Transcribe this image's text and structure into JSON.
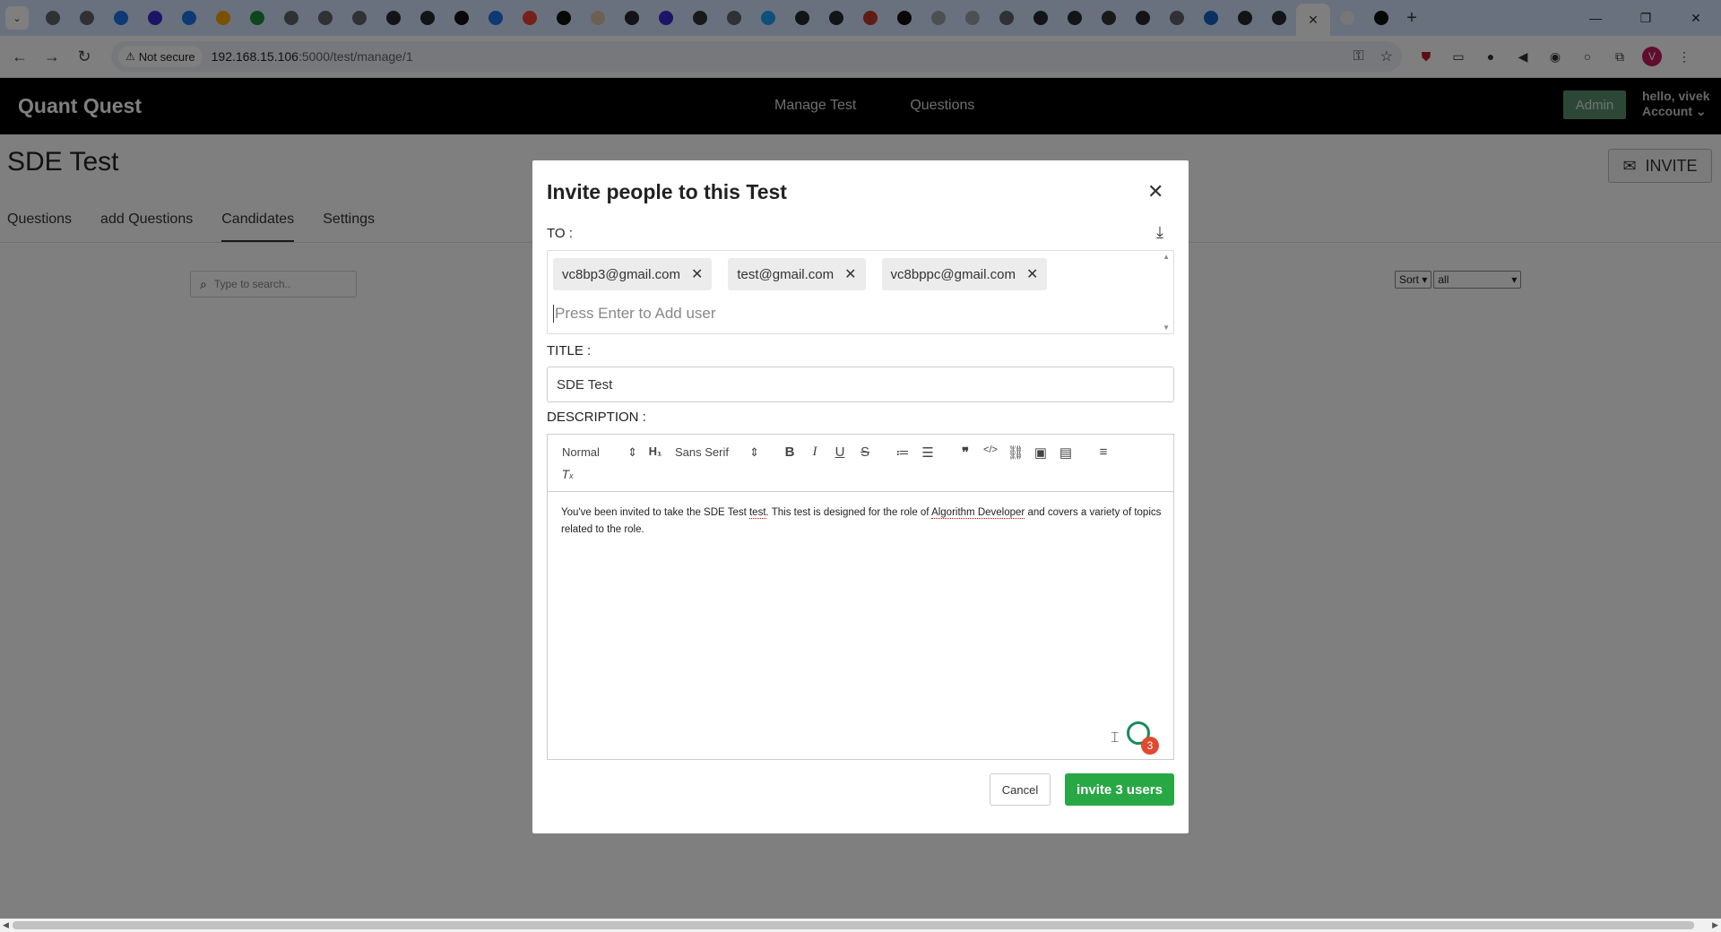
{
  "browser": {
    "tab_icons": [
      "chrome",
      "chrome",
      "google",
      "shield",
      "refresh",
      "orange",
      "n-logo",
      "chrome",
      "chrome",
      "chrome",
      "github",
      "github",
      "ai",
      "google",
      "maps",
      "medium",
      "chat",
      "circle",
      "hex",
      "x",
      "chrome",
      "twitter",
      "github",
      "github",
      "castle",
      "square",
      "cursor",
      "cursor",
      "chrome",
      "github",
      "circle",
      "x",
      "circle",
      "chrome",
      "hex",
      "github",
      "github",
      "doc",
      "ms"
    ],
    "active_tab_close": "✕",
    "not_secure": "Not secure",
    "url_host": "192.168.15.106",
    "url_path": ":5000/test/manage/1",
    "avatar_letter": "V"
  },
  "app": {
    "brand": "Quant Quest",
    "nav": [
      "Manage Test",
      "Questions"
    ],
    "admin": "Admin",
    "greeting": "hello, vivek",
    "account": "Account ⌄"
  },
  "page": {
    "title": "SDE Test",
    "invite": "INVITE",
    "tabs": [
      "Questions",
      "add Questions",
      "Candidates",
      "Settings"
    ],
    "active_tab": "Candidates",
    "search_placeholder": "Type to search..",
    "sort": "Sort",
    "filter": "all"
  },
  "modal": {
    "title": "Invite people to this Test",
    "to_label": "TO :",
    "chips": [
      "vc8bp3@gmail.com",
      "test@gmail.com",
      "vc8bppc@gmail.com"
    ],
    "to_placeholder": "Press Enter to Add user",
    "title_label": "TITLE :",
    "title_value": "SDE Test",
    "description_label": "DESCRIPTION :",
    "toolbar": {
      "format": "Normal",
      "font": "Sans Serif"
    },
    "description": {
      "part1": "You've been invited to take the SDE Test ",
      "spell1": "test",
      "part2": ". This test is designed for the role of ",
      "spell2": "Algorithm Developer",
      "part3": " and covers a variety of topics related to the role."
    },
    "badge_count": "3",
    "cancel": "Cancel",
    "submit": "invite 3 users"
  },
  "colors": {
    "primary_green": "#28a745",
    "navbar": "#000000",
    "admin_button": "#5b8f6e",
    "tabstrip": "#d3e3fd"
  }
}
